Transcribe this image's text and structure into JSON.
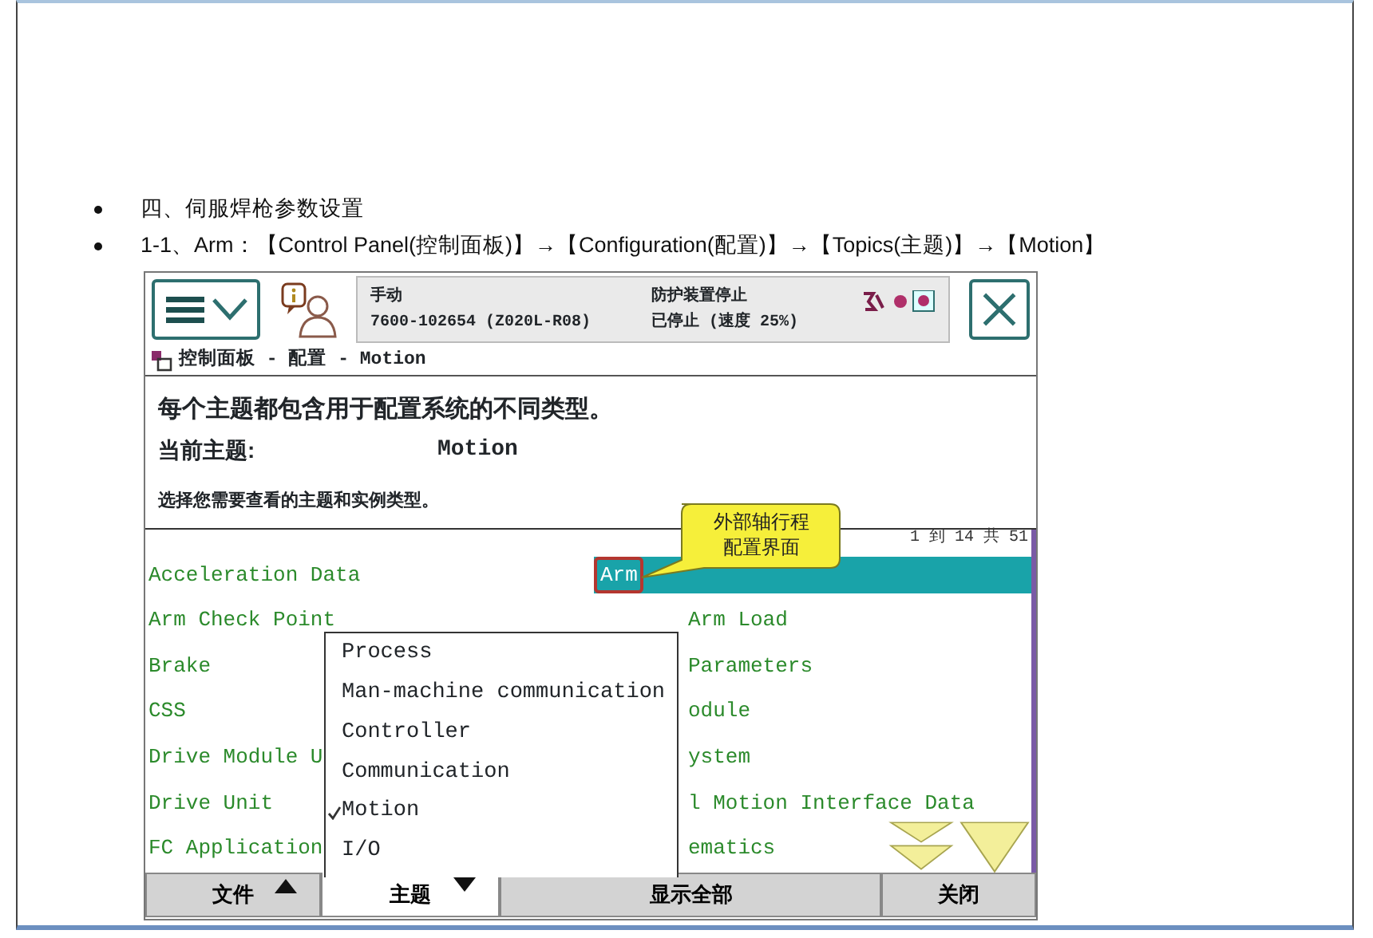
{
  "slide": {
    "heading": "四、伺服焊枪参数设置",
    "path": "1-1、Arm：【Control Panel(控制面板)】→【Configuration(配置)】→【Topics(主题)】→【Motion】"
  },
  "pendant": {
    "status": {
      "mode": "手动",
      "system": "7600-102654 (Z020L-R08)",
      "state": "防护装置停止",
      "speed": "已停止 (速度 25%)"
    },
    "breadcrumb": "控制面板 - 配置 - Motion",
    "description": "每个主题都包含用于配置系统的不同类型。",
    "current_topic_label": "当前主题:",
    "current_topic": "Motion",
    "instruction": "选择您需要查看的主题和实例类型。",
    "count": "1 到 14 共 51",
    "rows": [
      {
        "left": "Acceleration Data",
        "right": "Arm",
        "selected": true
      },
      {
        "left": "Arm Check Point",
        "right": "Arm Load",
        "selected": false
      },
      {
        "left": "Brake",
        "right": "Parameters",
        "selected": false
      },
      {
        "left": "CSS",
        "right": "odule",
        "selected": false
      },
      {
        "left": "Drive Module U",
        "right": "ystem",
        "selected": false
      },
      {
        "left": "Drive Unit",
        "right": "l Motion Interface Data",
        "selected": false
      },
      {
        "left": "FC Application",
        "right": "ematics",
        "selected": false
      }
    ],
    "callout": "外部轴行程配置界面",
    "topic_menu": [
      {
        "label": "Process",
        "checked": false
      },
      {
        "label": "Man-machine communication",
        "checked": false
      },
      {
        "label": "Controller",
        "checked": false
      },
      {
        "label": "Communication",
        "checked": false
      },
      {
        "label": "Motion",
        "checked": true
      },
      {
        "label": "I/O",
        "checked": false
      }
    ],
    "bottom_tabs": [
      {
        "label": "文件",
        "selected": false,
        "kind": "dropup"
      },
      {
        "label": "主题",
        "selected": true,
        "kind": "dropdown"
      },
      {
        "label": "显示全部",
        "selected": false,
        "kind": "plain"
      },
      {
        "label": "关闭",
        "selected": false,
        "kind": "plain"
      }
    ]
  }
}
